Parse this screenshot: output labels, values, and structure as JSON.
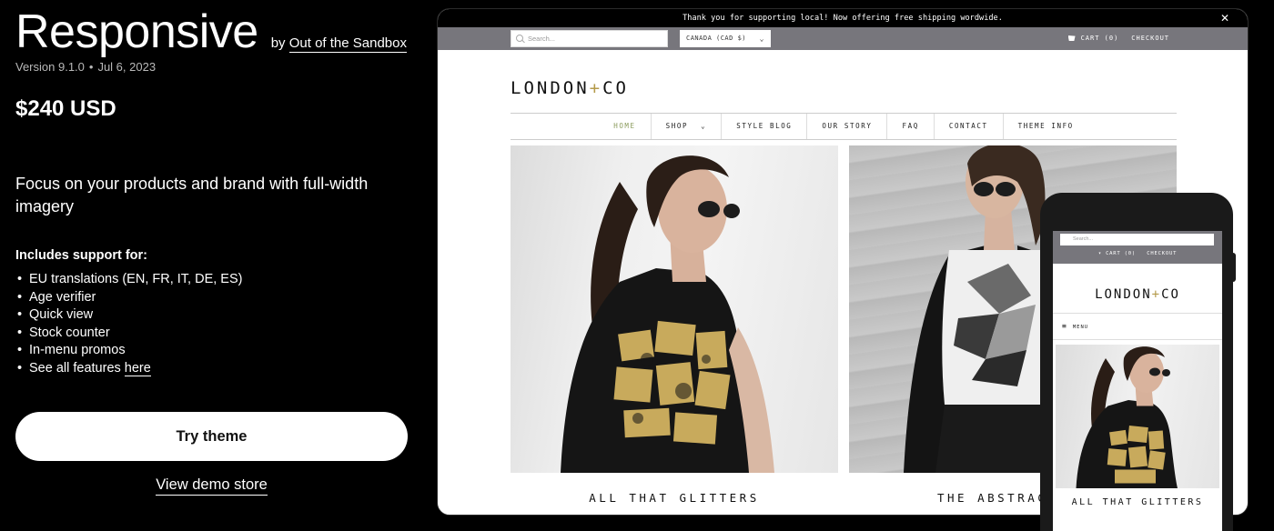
{
  "theme": {
    "name": "Responsive",
    "by_prefix": "by",
    "author": "Out of the Sandbox",
    "version": "Version 9.1.0",
    "date": "Jul 6, 2023",
    "price": "$240 USD",
    "tagline": "Focus on your products and brand with full-width imagery",
    "support_heading": "Includes support for:",
    "features": [
      "EU translations (EN, FR, IT, DE, ES)",
      "Age verifier",
      "Quick view",
      "Stock counter",
      "In-menu promos"
    ],
    "see_all_prefix": "See all features ",
    "see_all_link": "here",
    "try_button": "Try theme",
    "demo_link": "View demo store"
  },
  "desktop_preview": {
    "announcement": "Thank you for supporting local! Now offering free shipping wordwide.",
    "close_glyph": "✕",
    "search_placeholder": "Search...",
    "currency": "CANADA (CAD $)",
    "cart": "CART (0)",
    "checkout": "CHECKOUT",
    "logo_left": "LONDON",
    "logo_plus": "+",
    "logo_right": "CO",
    "nav": [
      "HOME",
      "SHOP",
      "STYLE BLOG",
      "OUR STORY",
      "FAQ",
      "CONTACT",
      "THEME INFO"
    ],
    "captions": [
      "ALL THAT GLITTERS",
      "THE ABSTRACT"
    ]
  },
  "mobile_preview": {
    "search_placeholder": "Search...",
    "cart": "CART (0)",
    "checkout": "CHECKOUT",
    "menu": "MENU",
    "caption": "ALL THAT GLITTERS"
  },
  "colors": {
    "background": "#000000",
    "topbar": "#77767c",
    "nav_active": "#8a9a5b",
    "logo_accent": "#b49a4a",
    "gold": "#c8aa5c"
  }
}
